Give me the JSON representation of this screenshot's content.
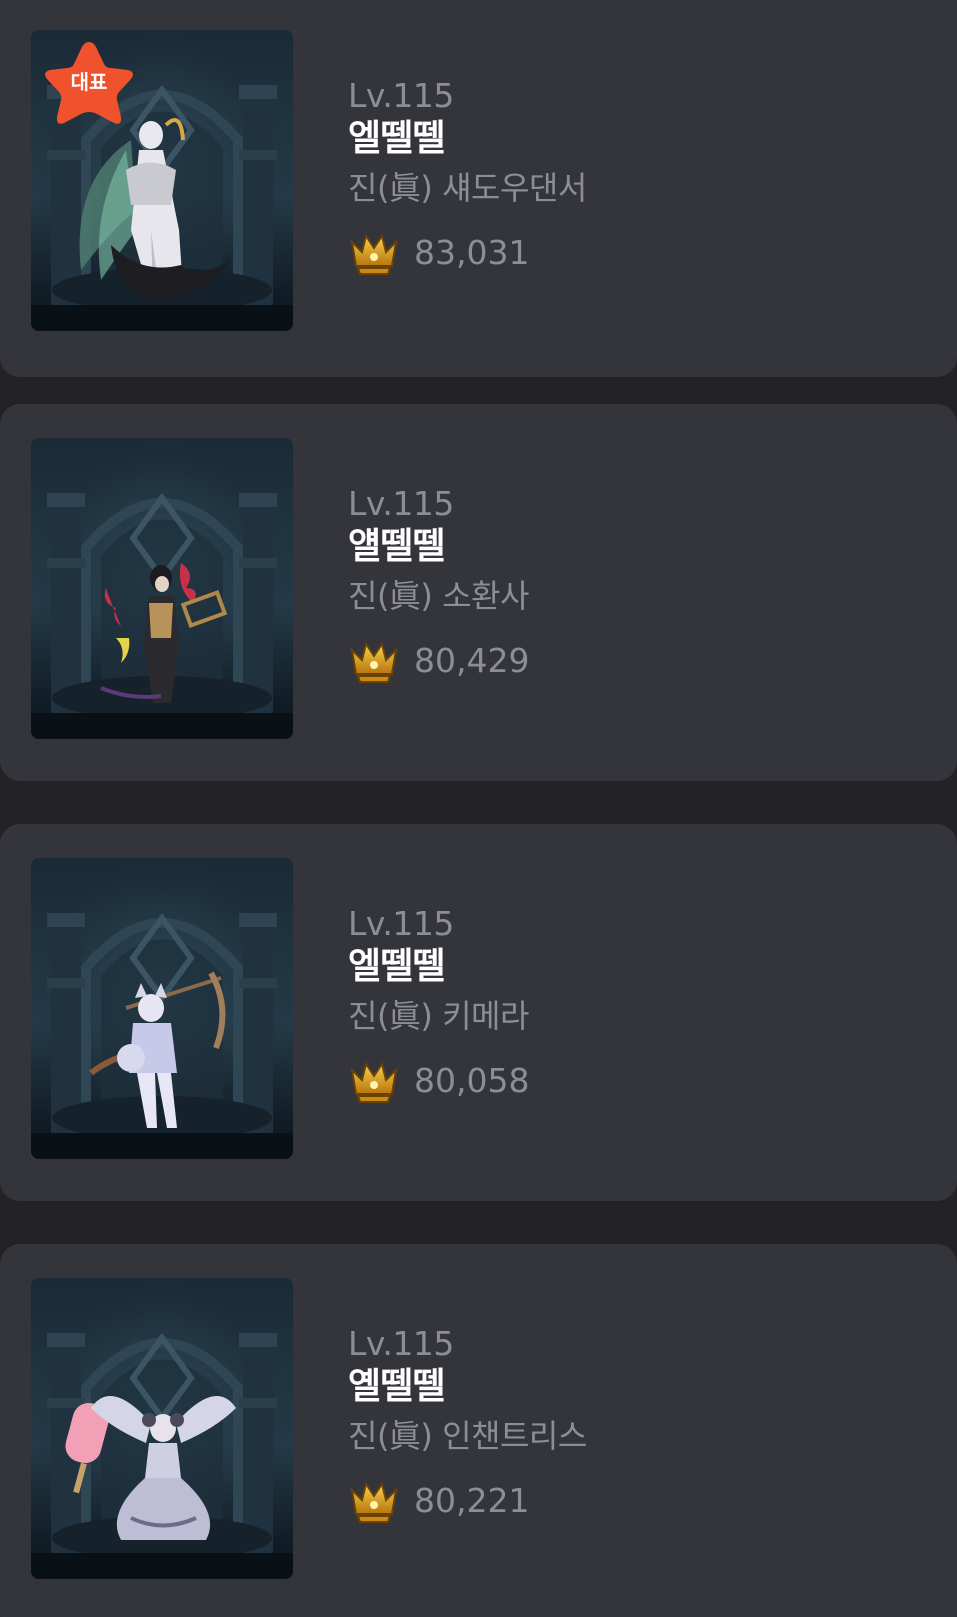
{
  "characters": [
    {
      "level": "Lv.115",
      "name": "엘뗄뗄",
      "job": "진(眞) 섀도우댄서",
      "fame": "83,031",
      "representative_badge": "대표",
      "portrait_icon": "character-portrait"
    },
    {
      "level": "Lv.115",
      "name": "얠뗄뗄",
      "job": "진(眞) 소환사",
      "fame": "80,429",
      "portrait_icon": "character-portrait"
    },
    {
      "level": "Lv.115",
      "name": "엘뗄뗄",
      "job": "진(眞) 키메라",
      "fame": "80,058",
      "portrait_icon": "character-portrait"
    },
    {
      "level": "Lv.115",
      "name": "옐뗄뗄",
      "job": "진(眞) 인챈트리스",
      "fame": "80,221",
      "portrait_icon": "character-portrait"
    }
  ],
  "colors": {
    "background": "#222227",
    "card": "#34343b",
    "muted_text": "#8d8d95",
    "name_text": "#ffffff",
    "badge": "#f0522d",
    "fame_icon": "#d9a21e"
  },
  "icons": {
    "fame": "fame-crown-icon",
    "badge": "star-badge-icon"
  }
}
